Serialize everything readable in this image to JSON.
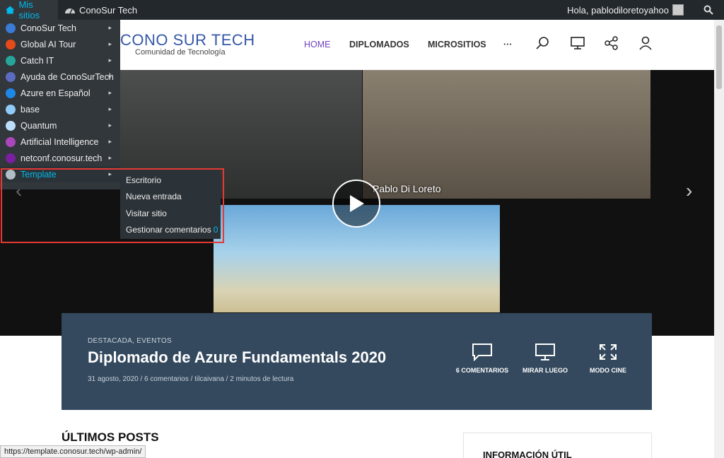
{
  "admin_bar": {
    "my_sites": "Mis sitios",
    "current_site": "ConoSur Tech",
    "greeting": "Hola, pablodiloretoyahoo"
  },
  "sites_menu": {
    "items": [
      {
        "label": "ConoSur Tech",
        "icon": "conosur-icon",
        "color": "#3a7bd5"
      },
      {
        "label": "Global AI Tour",
        "icon": "global-ai-icon",
        "color": "#e64a19"
      },
      {
        "label": "Catch IT",
        "icon": "catch-it-icon",
        "color": "#26a69a"
      },
      {
        "label": "Ayuda de ConoSurTech",
        "icon": "help-site-icon",
        "color": "#5c6bc0"
      },
      {
        "label": "Azure en Español",
        "icon": "azure-icon",
        "color": "#1e88e5"
      },
      {
        "label": "base",
        "icon": "base-site-icon",
        "color": "#90caf9"
      },
      {
        "label": "Quantum",
        "icon": "quantum-icon",
        "color": "#bbdefb"
      },
      {
        "label": "Artificial Intelligence",
        "icon": "ai-site-icon",
        "color": "#ab47bc"
      },
      {
        "label": "netconf.conosur.tech",
        "icon": "netconf-icon",
        "color": "#7b1fa2"
      },
      {
        "label": "Template",
        "icon": "template-site-icon",
        "color": "#b0bec5"
      }
    ]
  },
  "submenu": {
    "items": [
      {
        "label": "Escritorio"
      },
      {
        "label": "Nueva entrada"
      },
      {
        "label": "Visitar sitio"
      },
      {
        "label": "Gestionar comentarios",
        "count": "0"
      }
    ]
  },
  "header": {
    "logo_title": "CONO SUR TECH",
    "logo_subtitle": "Comunidad de Tecnología",
    "nav": [
      "HOME",
      "DIPLOMADOS",
      "MICROSITIOS",
      "···"
    ]
  },
  "hero": {
    "caption": "Pablo Di Loreto"
  },
  "card": {
    "categories": "DESTACADA, EVENTOS",
    "title": "Diplomado de Azure Fundamentals 2020",
    "meta": "31 agosto, 2020  /  6 comentarios  /  tilcaivana  /  2 minutos de lectura",
    "actions": [
      "6 COMENTARIOS",
      "MIRAR LUEGO",
      "MODO CINE"
    ]
  },
  "latest_title": "ÚLTIMOS POSTS",
  "info_title": "INFORMACIÓN ÚTIL",
  "status_url": "https://template.conosur.tech/wp-admin/",
  "colors": {
    "admin_bar": "#23282d",
    "accent": "#00b9eb",
    "card": "#34495e",
    "logo": "#3557a8",
    "nav_active": "#6f42c1",
    "highlight": "#e53935"
  }
}
